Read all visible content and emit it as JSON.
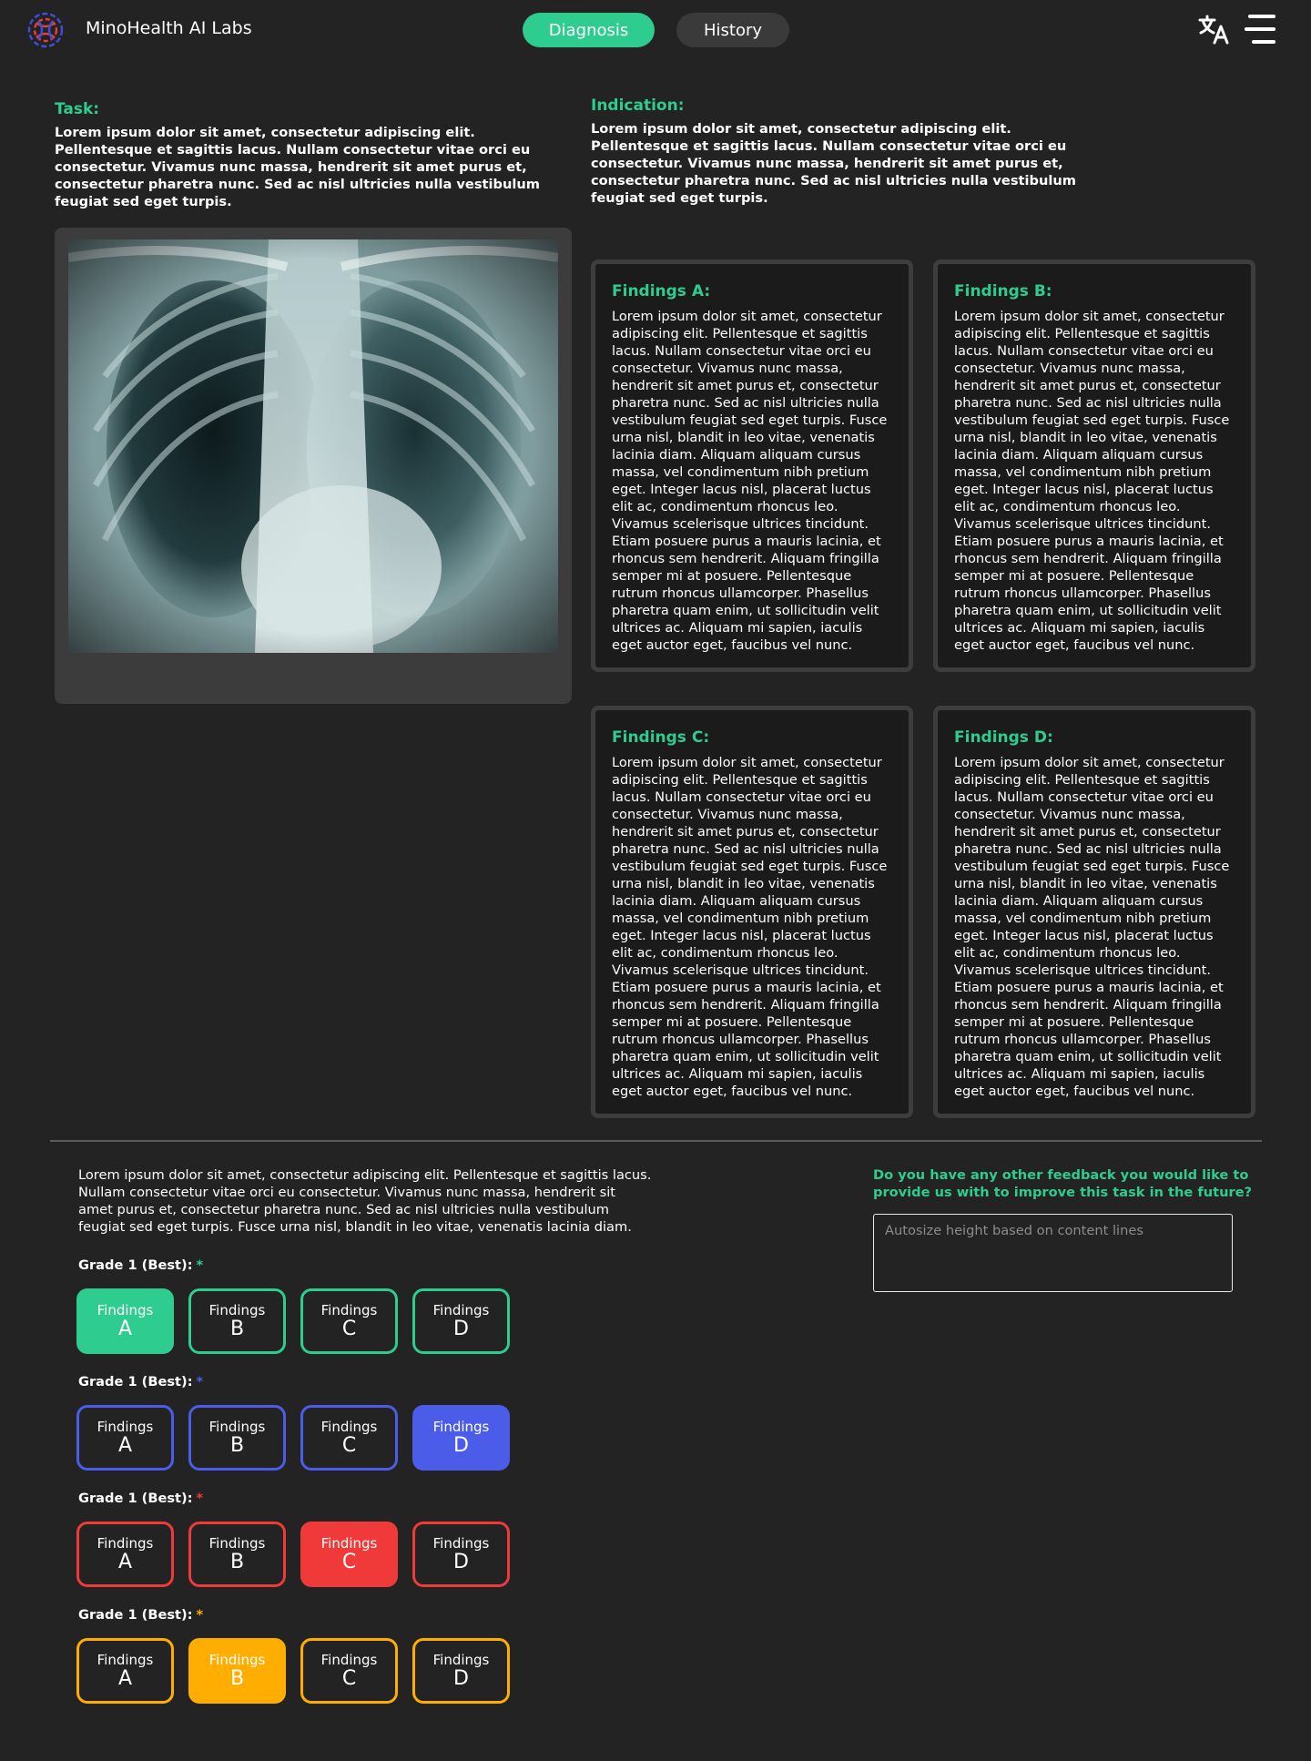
{
  "header": {
    "brand": "MinoHealth AI Labs",
    "nav": {
      "diagnosis": "Diagnosis",
      "history": "History"
    },
    "icons": {
      "translate": "translate-icon",
      "menu": "hamburger-menu-icon",
      "logo": "dna-logo-icon"
    }
  },
  "task": {
    "label": "Task:",
    "text": "Lorem ipsum dolor sit amet, consectetur adipiscing elit. Pellentesque et sagittis lacus. Nullam consectetur vitae orci eu consectetur. Vivamus nunc massa, hendrerit sit amet purus et, consectetur pharetra nunc. Sed ac nisl ultricies nulla vestibulum feugiat sed eget turpis."
  },
  "indication": {
    "label": "Indication:",
    "text": "Lorem ipsum dolor sit amet, consectetur adipiscing elit. Pellentesque et sagittis lacus. Nullam consectetur vitae orci eu consectetur. Vivamus nunc massa, hendrerit sit amet purus et, consectetur pharetra nunc. Sed ac nisl ultricies nulla vestibulum feugiat sed eget turpis."
  },
  "findings": [
    {
      "title": "Findings A:",
      "text": "Lorem ipsum dolor sit amet, consectetur adipiscing elit. Pellentesque et sagittis lacus. Nullam consectetur vitae orci eu consectetur. Vivamus nunc massa, hendrerit sit amet purus et, consectetur pharetra nunc. Sed ac nisl ultricies nulla vestibulum feugiat sed eget turpis. Fusce urna nisl, blandit in leo vitae, venenatis lacinia diam. Aliquam aliquam cursus massa, vel condimentum nibh pretium eget. Integer lacus nisl, placerat luctus elit ac, condimentum rhoncus leo. Vivamus scelerisque ultrices tincidunt. Etiam posuere purus a mauris lacinia, et rhoncus sem hendrerit. Aliquam fringilla semper mi at posuere. Pellentesque rutrum rhoncus ullamcorper. Phasellus pharetra quam enim, ut sollicitudin velit ultrices ac. Aliquam mi sapien, iaculis eget auctor eget, faucibus vel nunc."
    },
    {
      "title": "Findings B:",
      "text": "Lorem ipsum dolor sit amet, consectetur adipiscing elit. Pellentesque et sagittis lacus. Nullam consectetur vitae orci eu consectetur. Vivamus nunc massa, hendrerit sit amet purus et, consectetur pharetra nunc. Sed ac nisl ultricies nulla vestibulum feugiat sed eget turpis. Fusce urna nisl, blandit in leo vitae, venenatis lacinia diam. Aliquam aliquam cursus massa, vel condimentum nibh pretium eget. Integer lacus nisl, placerat luctus elit ac, condimentum rhoncus leo. Vivamus scelerisque ultrices tincidunt. Etiam posuere purus a mauris lacinia, et rhoncus sem hendrerit. Aliquam fringilla semper mi at posuere. Pellentesque rutrum rhoncus ullamcorper. Phasellus pharetra quam enim, ut sollicitudin velit ultrices ac. Aliquam mi sapien, iaculis eget auctor eget, faucibus vel nunc."
    },
    {
      "title": "Findings C:",
      "text": "Lorem ipsum dolor sit amet, consectetur adipiscing elit. Pellentesque et sagittis lacus. Nullam consectetur vitae orci eu consectetur. Vivamus nunc massa, hendrerit sit amet purus et, consectetur pharetra nunc. Sed ac nisl ultricies nulla vestibulum feugiat sed eget turpis. Fusce urna nisl, blandit in leo vitae, venenatis lacinia diam. Aliquam aliquam cursus massa, vel condimentum nibh pretium eget. Integer lacus nisl, placerat luctus elit ac, condimentum rhoncus leo. Vivamus scelerisque ultrices tincidunt. Etiam posuere purus a mauris lacinia, et rhoncus sem hendrerit. Aliquam fringilla semper mi at posuere. Pellentesque rutrum rhoncus ullamcorper. Phasellus pharetra quam enim, ut sollicitudin velit ultrices ac. Aliquam mi sapien, iaculis eget auctor eget, faucibus vel nunc."
    },
    {
      "title": "Findings D:",
      "text": "Lorem ipsum dolor sit amet, consectetur adipiscing elit. Pellentesque et sagittis lacus. Nullam consectetur vitae orci eu consectetur. Vivamus nunc massa, hendrerit sit amet purus et, consectetur pharetra nunc. Sed ac nisl ultricies nulla vestibulum feugiat sed eget turpis. Fusce urna nisl, blandit in leo vitae, venenatis lacinia diam. Aliquam aliquam cursus massa, vel condimentum nibh pretium eget. Integer lacus nisl, placerat luctus elit ac, condimentum rhoncus leo. Vivamus scelerisque ultrices tincidunt. Etiam posuere purus a mauris lacinia, et rhoncus sem hendrerit. Aliquam fringilla semper mi at posuere. Pellentesque rutrum rhoncus ullamcorper. Phasellus pharetra quam enim, ut sollicitudin velit ultrices ac. Aliquam mi sapien, iaculis eget auctor eget, faucibus vel nunc."
    }
  ],
  "intro_text": "Lorem ipsum dolor sit amet, consectetur adipiscing elit. Pellentesque et sagittis lacus. Nullam consectetur vitae orci eu consectetur. Vivamus nunc massa, hendrerit sit amet purus et, consectetur pharetra nunc. Sed ac nisl ultricies nulla vestibulum feugiat sed eget turpis. Fusce urna nisl, blandit in leo vitae, venenatis lacinia diam.",
  "grades": [
    {
      "label": "Grade 1 (Best):",
      "star": "*",
      "color": "#2ecc8f",
      "selected": "A",
      "options": [
        {
          "word": "Findings",
          "letter": "A"
        },
        {
          "word": "Findings",
          "letter": "B"
        },
        {
          "word": "Findings",
          "letter": "C"
        },
        {
          "word": "Findings",
          "letter": "D"
        }
      ]
    },
    {
      "label": "Grade 1 (Best):",
      "star": "*",
      "color": "#4a5ce8",
      "selected": "D",
      "options": [
        {
          "word": "Findings",
          "letter": "A"
        },
        {
          "word": "Findings",
          "letter": "B"
        },
        {
          "word": "Findings",
          "letter": "C"
        },
        {
          "word": "Findings",
          "letter": "D"
        }
      ]
    },
    {
      "label": "Grade 1 (Best):",
      "star": "*",
      "color": "#f03a3a",
      "selected": "C",
      "options": [
        {
          "word": "Findings",
          "letter": "A"
        },
        {
          "word": "Findings",
          "letter": "B"
        },
        {
          "word": "Findings",
          "letter": "C"
        },
        {
          "word": "Findings",
          "letter": "D"
        }
      ]
    },
    {
      "label": "Grade 1 (Best):",
      "star": "*",
      "color": "#ffae00",
      "selected": "B",
      "options": [
        {
          "word": "Findings",
          "letter": "A"
        },
        {
          "word": "Findings",
          "letter": "B"
        },
        {
          "word": "Findings",
          "letter": "C"
        },
        {
          "word": "Findings",
          "letter": "D"
        }
      ]
    }
  ],
  "feedback": {
    "question": "Do you have any other feedback you would like to provide us with to improve this task in the future?",
    "placeholder": "Autosize height based on content lines",
    "value": ""
  },
  "colors": {
    "accent": "#2ecc8f",
    "background": "#232323",
    "card": "#1b1b1b"
  }
}
